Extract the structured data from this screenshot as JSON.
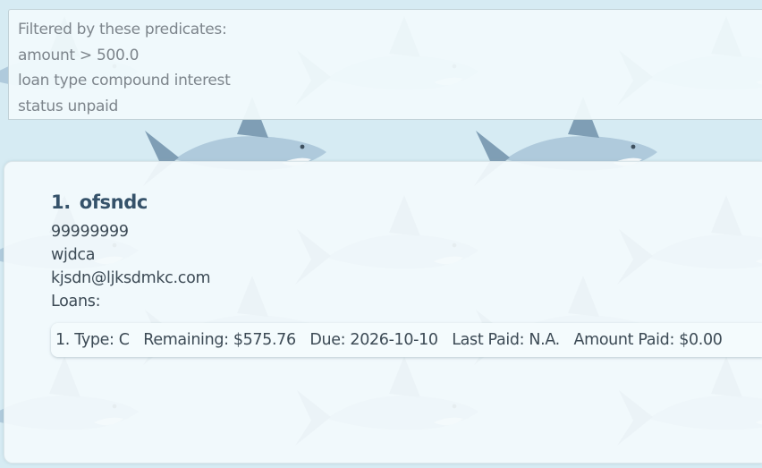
{
  "filters": {
    "heading": "Filtered by these predicates:",
    "predicates": [
      "amount > 500.0",
      "loan type compound interest",
      "status unpaid"
    ]
  },
  "person": {
    "index": "1.",
    "name": "ofsndc",
    "phone": "99999999",
    "address": "wjdca",
    "email": "kjsdn@ljksdmkc.com",
    "loans_label": "Loans:"
  },
  "loans": [
    {
      "index": "1.",
      "type": "Type: C",
      "remaining": "Remaining: $575.76",
      "due": "Due: 2026-10-10",
      "last_paid": "Last Paid: N.A.",
      "amount_paid": "Amount Paid: $0.00"
    }
  ],
  "colors": {
    "background": "#d6ebf3",
    "shark_body": "#a8c4d8",
    "shark_fin": "#6f90aa",
    "shark_mouth": "#c0504d",
    "panel": "#f1fafc"
  },
  "icons": [
    "shark-pattern-icon"
  ]
}
